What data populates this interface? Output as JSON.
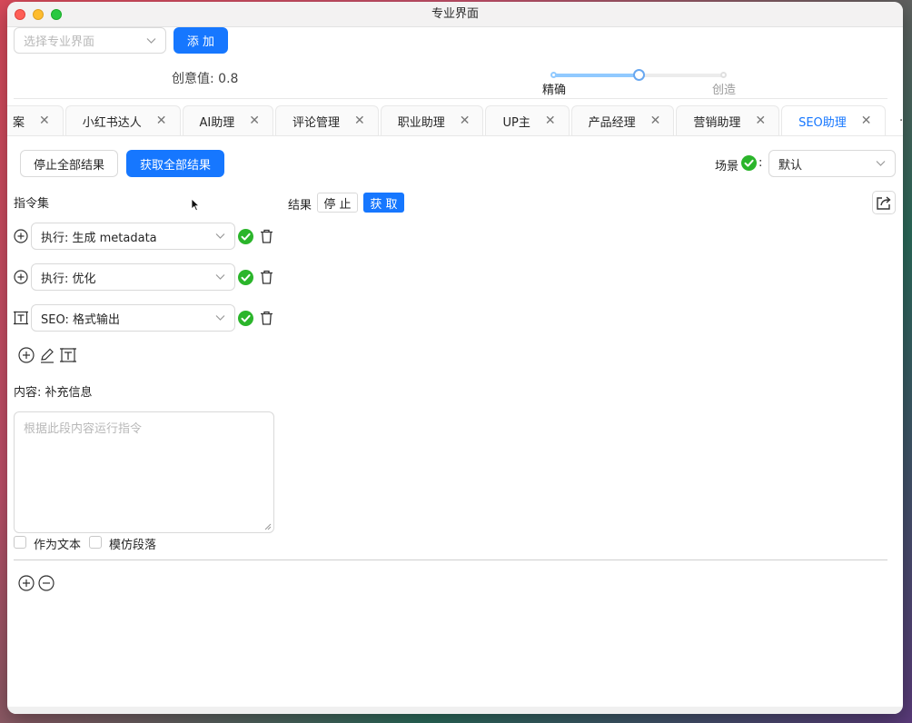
{
  "window": {
    "title": "专业界面"
  },
  "topbar": {
    "mode_select_placeholder": "选择专业界面",
    "add_button": "添 加",
    "creativity_label": "创意值: 0.8",
    "creativity_value": 0.8,
    "slider_left_mark": "精确",
    "slider_right_mark": "创造"
  },
  "tabs": [
    {
      "label": "案"
    },
    {
      "label": "小红书达人"
    },
    {
      "label": "AI助理"
    },
    {
      "label": "评论管理"
    },
    {
      "label": "职业助理"
    },
    {
      "label": "UP主"
    },
    {
      "label": "产品经理"
    },
    {
      "label": "营销助理"
    },
    {
      "label": "SEO助理",
      "active": true
    }
  ],
  "tabs_more": "···",
  "actions": {
    "stop_all": "停止全部结果",
    "get_all": "获取全部结果",
    "scene_label": "场景",
    "scene_colon": ":",
    "scene_value": "默认"
  },
  "instructions": {
    "title": "指令集",
    "items": [
      {
        "value": "执行: 生成 metadata"
      },
      {
        "value": "执行: 优化"
      },
      {
        "value": "SEO: 格式输出"
      }
    ]
  },
  "results": {
    "label": "结果",
    "stop": "停 止",
    "get": "获 取"
  },
  "content": {
    "label": "内容: 补充信息",
    "placeholder": "根据此段内容运行指令",
    "as_text": "作为文本",
    "imitate": "模仿段落"
  },
  "colors": {
    "accent": "#1677ff",
    "success": "#2bb52b"
  }
}
